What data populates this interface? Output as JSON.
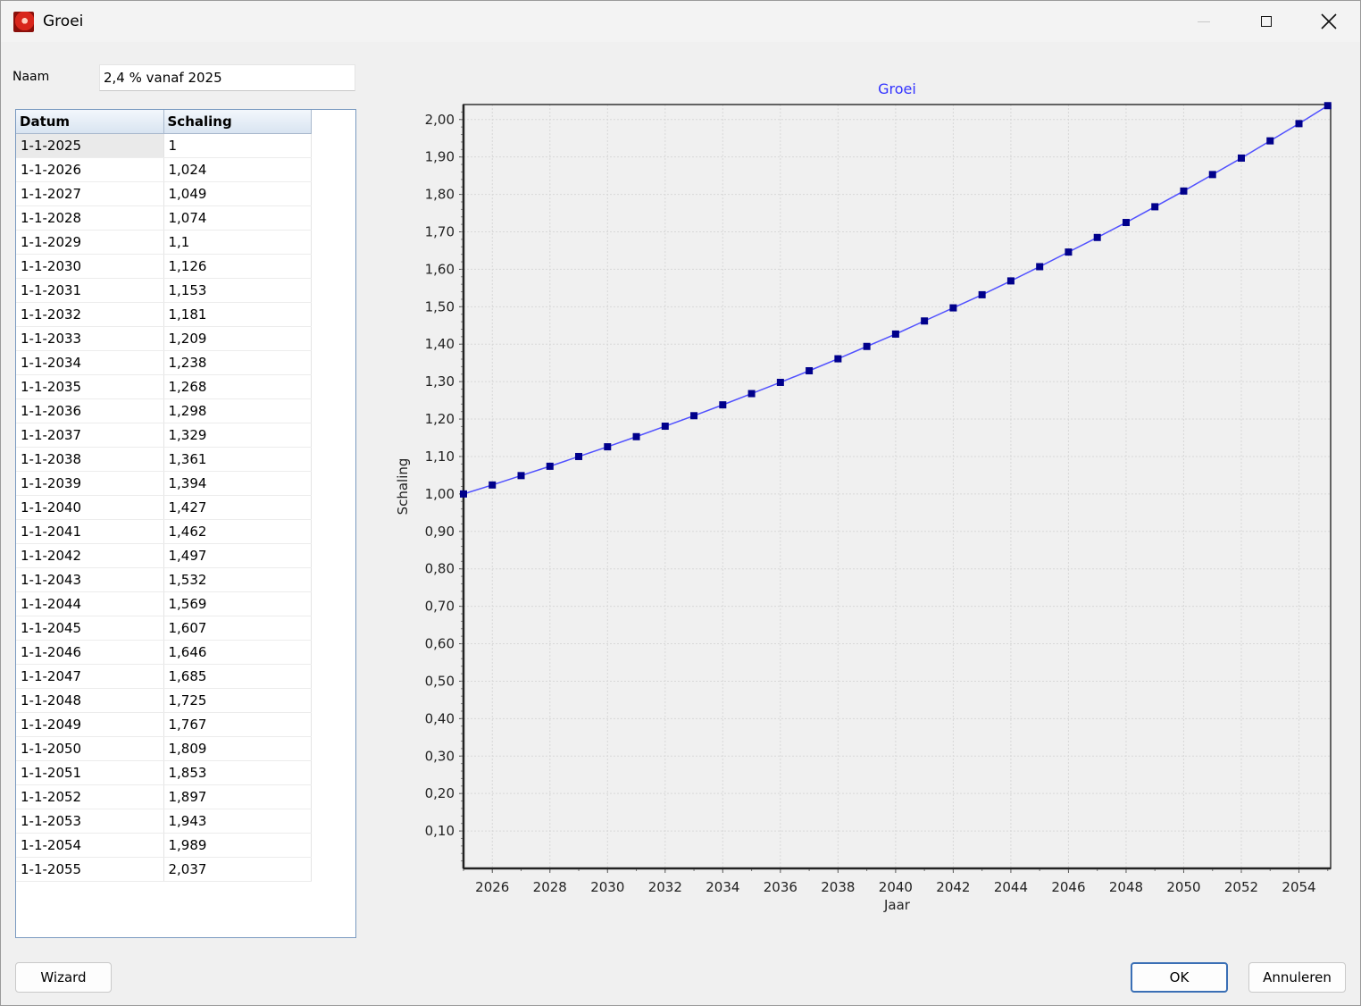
{
  "window": {
    "title": "Groei",
    "icon": "app-logo-icon"
  },
  "form": {
    "naam_label": "Naam",
    "naam_value": "2,4 % vanaf 2025"
  },
  "table": {
    "columns": [
      "Datum",
      "Schaling"
    ],
    "rows": [
      [
        "1-1-2025",
        "1"
      ],
      [
        "1-1-2026",
        "1,024"
      ],
      [
        "1-1-2027",
        "1,049"
      ],
      [
        "1-1-2028",
        "1,074"
      ],
      [
        "1-1-2029",
        "1,1"
      ],
      [
        "1-1-2030",
        "1,126"
      ],
      [
        "1-1-2031",
        "1,153"
      ],
      [
        "1-1-2032",
        "1,181"
      ],
      [
        "1-1-2033",
        "1,209"
      ],
      [
        "1-1-2034",
        "1,238"
      ],
      [
        "1-1-2035",
        "1,268"
      ],
      [
        "1-1-2036",
        "1,298"
      ],
      [
        "1-1-2037",
        "1,329"
      ],
      [
        "1-1-2038",
        "1,361"
      ],
      [
        "1-1-2039",
        "1,394"
      ],
      [
        "1-1-2040",
        "1,427"
      ],
      [
        "1-1-2041",
        "1,462"
      ],
      [
        "1-1-2042",
        "1,497"
      ],
      [
        "1-1-2043",
        "1,532"
      ],
      [
        "1-1-2044",
        "1,569"
      ],
      [
        "1-1-2045",
        "1,607"
      ],
      [
        "1-1-2046",
        "1,646"
      ],
      [
        "1-1-2047",
        "1,685"
      ],
      [
        "1-1-2048",
        "1,725"
      ],
      [
        "1-1-2049",
        "1,767"
      ],
      [
        "1-1-2050",
        "1,809"
      ],
      [
        "1-1-2051",
        "1,853"
      ],
      [
        "1-1-2052",
        "1,897"
      ],
      [
        "1-1-2053",
        "1,943"
      ],
      [
        "1-1-2054",
        "1,989"
      ],
      [
        "1-1-2055",
        "2,037"
      ]
    ]
  },
  "buttons": {
    "wizard": "Wizard",
    "ok": "OK",
    "cancel": "Annuleren"
  },
  "colors": {
    "series": "#5050ff",
    "marker": "#00008b",
    "title": "#3333ff"
  },
  "chart_data": {
    "type": "line",
    "title": "Groei",
    "xlabel": "Jaar",
    "ylabel": "Schaling",
    "x": [
      2025,
      2026,
      2027,
      2028,
      2029,
      2030,
      2031,
      2032,
      2033,
      2034,
      2035,
      2036,
      2037,
      2038,
      2039,
      2040,
      2041,
      2042,
      2043,
      2044,
      2045,
      2046,
      2047,
      2048,
      2049,
      2050,
      2051,
      2052,
      2053,
      2054,
      2055
    ],
    "series": [
      {
        "values": [
          1.0,
          1.024,
          1.049,
          1.074,
          1.1,
          1.126,
          1.153,
          1.181,
          1.209,
          1.238,
          1.268,
          1.298,
          1.329,
          1.361,
          1.394,
          1.427,
          1.462,
          1.497,
          1.532,
          1.569,
          1.607,
          1.646,
          1.685,
          1.725,
          1.767,
          1.809,
          1.853,
          1.897,
          1.943,
          1.989,
          2.037
        ]
      }
    ],
    "xlim": [
      2025,
      2055.1
    ],
    "ylim": [
      0,
      2.04
    ],
    "xticks": [
      "2026",
      "2028",
      "2030",
      "2032",
      "2034",
      "2036",
      "2038",
      "2040",
      "2042",
      "2044",
      "2046",
      "2048",
      "2050",
      "2052",
      "2054"
    ],
    "yticks": [
      "0,10",
      "0,20",
      "0,30",
      "0,40",
      "0,50",
      "0,60",
      "0,70",
      "0,80",
      "0,90",
      "1,00",
      "1,10",
      "1,20",
      "1,30",
      "1,40",
      "1,50",
      "1,60",
      "1,70",
      "1,80",
      "1,90",
      "2,00"
    ],
    "grid": true,
    "legend": "none"
  }
}
